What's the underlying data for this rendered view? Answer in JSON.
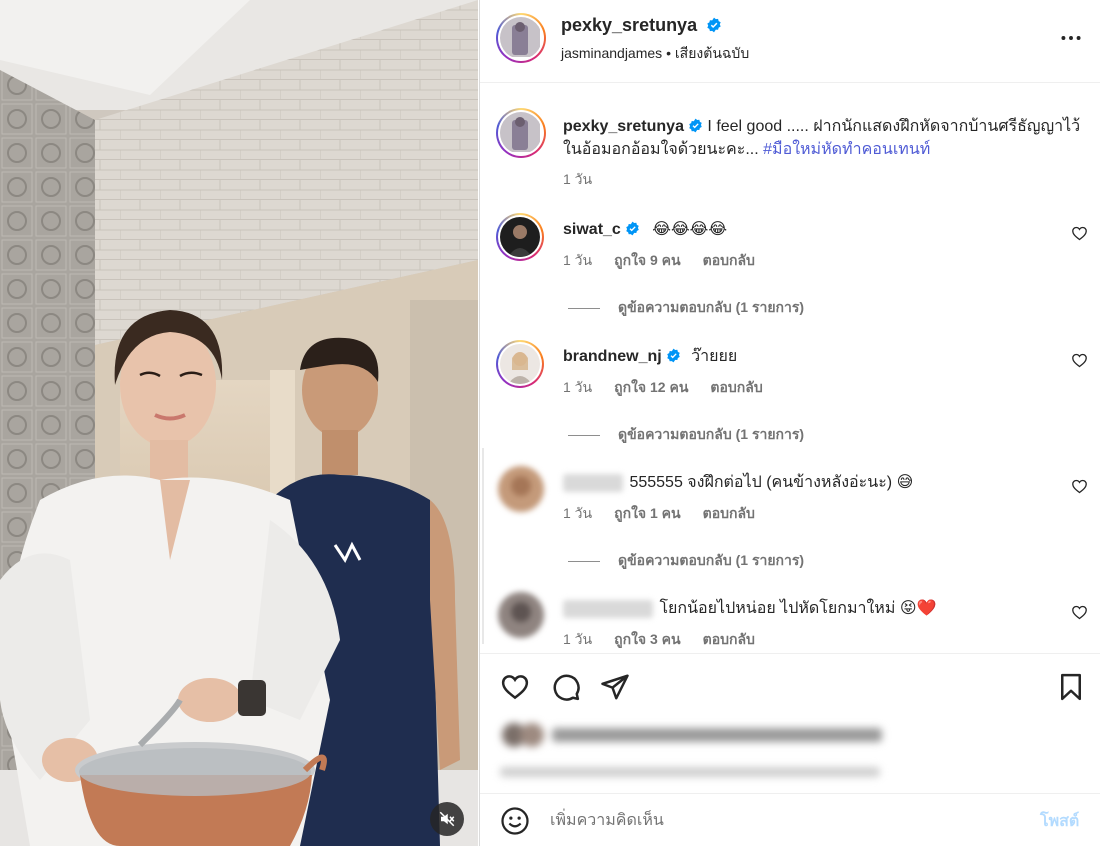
{
  "colors": {
    "verified": "#0095f6",
    "hashtag": "#4f5bd5",
    "post_disabled": "#b3dbff",
    "heart_red": "#ed4956"
  },
  "post": {
    "author": "pexky_sretunya",
    "audio_owner": "jasminandjames",
    "audio_separator": "•",
    "audio_label": "เสียงต้นฉบับ",
    "caption_text": "I feel good ..... ฝากนักแสดงฝึกหัดจากบ้านศรีธัญญาไว้ในอ้อมอกอ้อมใจด้วยนะคะ...",
    "hashtag": "#มือใหม่หัดทำคอนเทนท์",
    "caption_time": "1 วัน"
  },
  "comments": [
    {
      "username": "siwat_c",
      "verified": true,
      "text": "😂😂😂😂",
      "time": "1 วัน",
      "likes": "ถูกใจ 9 คน",
      "reply": "ตอบกลับ",
      "view_replies": "ดูข้อความตอบกลับ (1 รายการ)"
    },
    {
      "username": "brandnew_nj",
      "verified": true,
      "text": "ว๊ายยย",
      "time": "1 วัน",
      "likes": "ถูกใจ 12 คน",
      "reply": "ตอบกลับ",
      "view_replies": "ดูข้อความตอบกลับ (1 รายการ)"
    },
    {
      "username_hidden": true,
      "text": "555555 จงฝึกต่อไป (คนข้างหลังอ่ะนะ) 😅",
      "time": "1 วัน",
      "likes": "ถูกใจ 1 คน",
      "reply": "ตอบกลับ",
      "view_replies": "ดูข้อความตอบกลับ (1 รายการ)"
    },
    {
      "username_hidden": true,
      "text": "โยกน้อยไปหน่อย ไปหัดโยกมาใหม่ 😝❤️",
      "time": "1 วัน",
      "likes": "ถูกใจ 3 คน",
      "reply": "ตอบกลับ"
    }
  ],
  "composer": {
    "placeholder": "เพิ่มความคิดเห็น",
    "post_label": "โพสต์"
  },
  "icons": [
    "more-icon",
    "verified-icon",
    "heart-icon",
    "comment-icon",
    "share-icon",
    "bookmark-icon",
    "emoji-icon",
    "mute-icon"
  ]
}
